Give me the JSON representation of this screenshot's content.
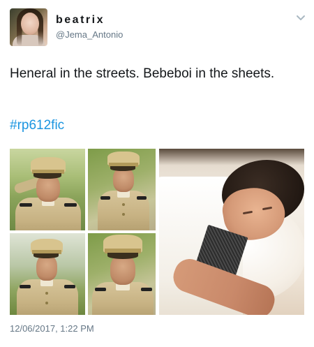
{
  "tweet": {
    "display_name": "beatrix",
    "handle": "@Jema_Antonio",
    "text": "Heneral in the streets. Bebeboi in the sheets.",
    "hashtag": "#rp612fic",
    "timestamp": "12/06/2017, 1:22 PM"
  },
  "media": {
    "photos": [
      {
        "label": "photo-1"
      },
      {
        "label": "photo-2"
      },
      {
        "label": "photo-3"
      },
      {
        "label": "photo-4"
      },
      {
        "label": "photo-5"
      }
    ]
  },
  "icons": {
    "avatar": "user-avatar",
    "menu": "chevron-down-icon"
  },
  "colors": {
    "text": "#14171a",
    "secondary": "#657786",
    "link": "#1b95e0"
  }
}
